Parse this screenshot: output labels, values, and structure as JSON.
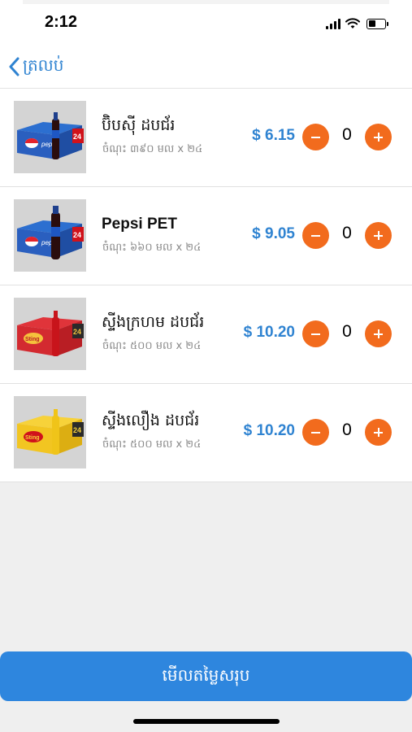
{
  "status": {
    "time": "2:12"
  },
  "nav": {
    "back_label": "ត្រលប់"
  },
  "products": [
    {
      "name": "ប៊ិបស៊ី ដបជ័រ",
      "desc": "ចំណុះ ៣៩០ មល x ២៤",
      "price": "$ 6.15",
      "qty": "0",
      "image": "pepsi-can-pack"
    },
    {
      "name": "Pepsi PET",
      "desc": "ចំណុះ ៦៦០ មល x ២៤",
      "price": "$ 9.05",
      "qty": "0",
      "image": "pepsi-pet-pack"
    },
    {
      "name": "ស្ទីងក្រហម ដបជ័រ",
      "desc": "ចំណុះ ៥០០ មល x ២៤",
      "price": "$ 10.20",
      "qty": "0",
      "image": "sting-red-pack"
    },
    {
      "name": "ស្ទីងលឿង ដបជ័រ",
      "desc": "ចំណុះ ៥០០ មល x ២៤",
      "price": "$ 10.20",
      "qty": "0",
      "image": "sting-yellow-pack"
    }
  ],
  "footer": {
    "view_total_label": "មើលតម្លៃសរុប"
  },
  "colors": {
    "accent_blue": "#2e86de",
    "price_blue": "#2f83d1",
    "stepper_orange": "#f26b1d"
  }
}
